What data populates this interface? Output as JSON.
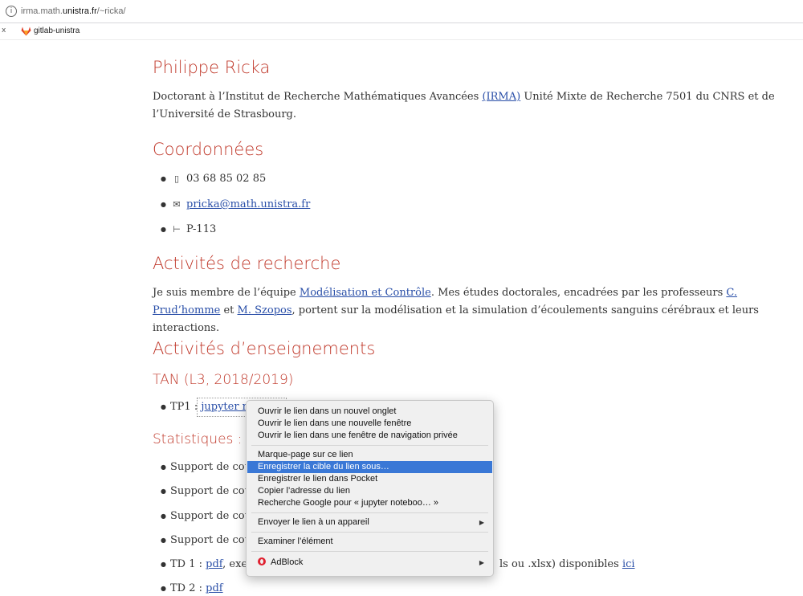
{
  "browser": {
    "url_prefix": "irma.math.",
    "url_domain": "unistra.fr",
    "url_path": "/~ricka/",
    "bookmark_left": "x",
    "bookmark_label": "gitlab-unistra"
  },
  "page": {
    "name": "Philippe Ricka",
    "intro_before": "Doctorant à l’Institut de Recherche Mathématiques Avancées ",
    "intro_link": "(IRMA)",
    "intro_after": " Unité Mixte de Recherche 7501 du CNRS et de l’Université de Strasbourg.",
    "coord_title": "Coordonnées",
    "phone": "03 68 85 02 85",
    "email": "pricka@math.unistra.fr",
    "office": "P-113",
    "research_title": "Activités de recherche",
    "research_1": "Je suis membre de l’équipe ",
    "research_link_team": "Modélisation et Contrôle",
    "research_2": ". Mes études doctorales, encadrées par les professeurs ",
    "research_link_prud": "C. Prud’homme",
    "research_3": " et ",
    "research_link_szopos": "M. Szopos",
    "research_4": ", portent sur la modélisation et la simulation d’écoulements sanguins cérébraux et leurs interactions.",
    "teaching_title": "Activités d’enseignements",
    "tan_title": "TAN (L3, 2018/2019)",
    "tp1_label": "TP1 : ",
    "tp1_link": "jupyter n",
    "stats_title": "Statistiques : e",
    "support_items": [
      "Support de cou",
      "Support de cou",
      "Support de cou",
      "Support de cou"
    ],
    "td1_label": "TD 1 : ",
    "td1_pdf": "pdf",
    "td1_mid": ", exer",
    "td1_tail": "ls ou .xlsx) disponibles ",
    "td1_link": "ici",
    "td2_label": "TD 2 : ",
    "td2_pdf": "pdf"
  },
  "context_menu": {
    "items": [
      "Ouvrir le lien dans un nouvel onglet",
      "Ouvrir le lien dans une nouvelle fenêtre",
      "Ouvrir le lien dans une fenêtre de navigation privée",
      "Marque-page sur ce lien",
      "Enregistrer la cible du lien sous…",
      "Enregistrer le lien dans Pocket",
      "Copier l’adresse du lien",
      "Recherche Google pour « jupyter noteboo… »",
      "Envoyer le lien à un appareil",
      "Examiner l’élément",
      "AdBlock"
    ],
    "highlighted_index": 4,
    "highlight_color": "#3a78d6"
  },
  "colors": {
    "heading": "#c0392b",
    "link": "#2a4fa8"
  },
  "icons": {
    "info": "info-icon",
    "phone": "phone-icon",
    "email": "mail-icon",
    "office": "office-icon",
    "adblock": "opera-icon",
    "submenu": "chevron-right-icon"
  }
}
